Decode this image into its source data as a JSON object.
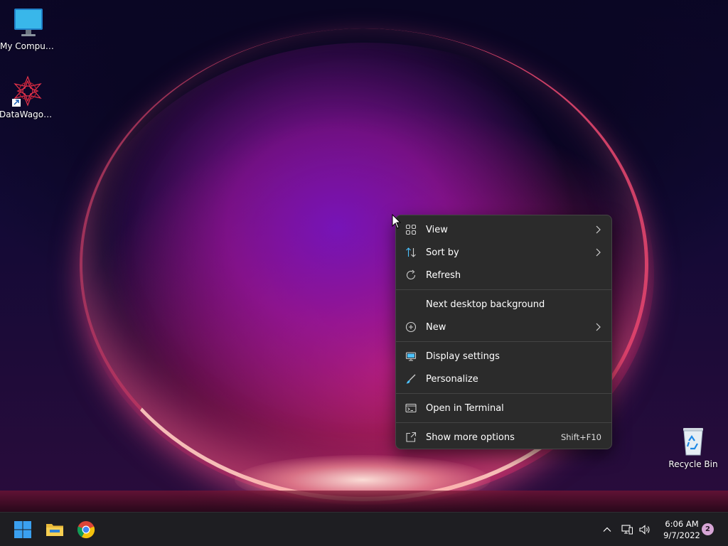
{
  "desktop": {
    "icons": [
      {
        "label": "My Computer",
        "icon": "monitor-icon"
      },
      {
        "label": "DataWagon...",
        "icon": "datawagon-app-icon"
      },
      {
        "label": "Recycle Bin",
        "icon": "recycle-bin-icon"
      }
    ]
  },
  "context_menu": {
    "items": [
      {
        "label": "View",
        "icon": "grid-icon",
        "submenu": true
      },
      {
        "label": "Sort by",
        "icon": "sort-icon",
        "submenu": true
      },
      {
        "label": "Refresh",
        "icon": "refresh-icon",
        "submenu": false
      },
      {
        "label": "Next desktop background",
        "icon": "",
        "submenu": false
      },
      {
        "label": "New",
        "icon": "plus-circle-icon",
        "submenu": true
      },
      {
        "label": "Display settings",
        "icon": "display-icon",
        "submenu": false
      },
      {
        "label": "Personalize",
        "icon": "brush-icon",
        "submenu": false
      },
      {
        "label": "Open in Terminal",
        "icon": "terminal-icon",
        "submenu": false
      },
      {
        "label": "Show more options",
        "icon": "share-icon",
        "submenu": false,
        "shortcut": "Shift+F10"
      }
    ]
  },
  "taskbar": {
    "apps": [
      {
        "name": "start",
        "icon": "windows-start-icon"
      },
      {
        "name": "file explorer",
        "icon": "folder-icon"
      },
      {
        "name": "chrome",
        "icon": "chrome-icon"
      }
    ],
    "tray": {
      "time": "6:06 AM",
      "date": "9/7/2022",
      "notifications": "2"
    }
  },
  "colors": {
    "menu_bg": "#2b2b2b",
    "taskbar_bg": "#1e1e22",
    "accent": "#0078d4"
  }
}
